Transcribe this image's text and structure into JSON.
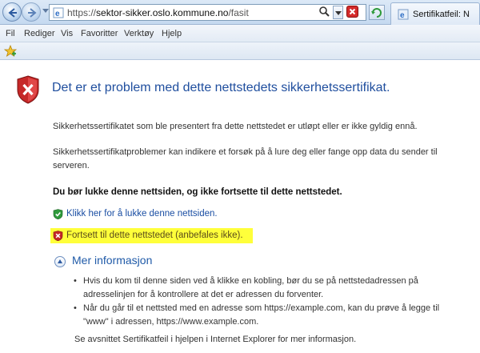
{
  "browser": {
    "url_scheme": "https://",
    "url_host": "sektor-sikker.oslo.kommune.no",
    "url_path": "/fasit",
    "tab_title": "Sertifikatfeil: N"
  },
  "menu": {
    "items": [
      "Fil",
      "Rediger",
      "Vis",
      "Favoritter",
      "Verktøy",
      "Hjelp"
    ]
  },
  "page": {
    "heading": "Det er et problem med dette nettstedets sikkerhetssertifikat.",
    "para1": "Sikkerhetssertifikatet som ble presentert fra dette nettstedet er utløpt eller er ikke gyldig ennå.",
    "para2": "Sikkerhetssertifikatproblemer kan indikere et forsøk på å lure deg eller fange opp data du sender til serveren.",
    "recommendation": "Du bør lukke denne nettsiden, og ikke fortsette til dette nettstedet.",
    "close_link": "Klikk her for å lukke denne nettsiden.",
    "continue_link": "Fortsett til dette nettstedet (anbefales ikke).",
    "more_info": "Mer informasjon",
    "bullets": [
      "Hvis du kom til denne siden ved å klikke en kobling, bør du se på nettstedadressen på adresselinjen for å kontrollere at det er adressen du forventer.",
      "Når du går til et nettsted med en adresse som https://example.com, kan du prøve å legge til \"www\" i adressen, https://www.example.com."
    ],
    "footer": "Se avsnittet Sertifikatfeil i hjelpen i Internet Explorer for mer informasjon."
  },
  "colors": {
    "heading": "#1f4e9e",
    "link": "#1a4ea3",
    "highlight": "#ffff3a",
    "error_red": "#d42a2a"
  },
  "icons": {
    "back": "back-arrow-icon",
    "forward": "forward-arrow-icon",
    "page": "ie-page-icon",
    "search": "search-icon",
    "certificate_error": "certificate-error-icon",
    "refresh": "refresh-icon",
    "favorites": "favorites-star-icon",
    "shield": "error-shield-icon",
    "close_link": "green-shield-check-icon",
    "continue_link": "red-shield-x-icon",
    "more_info": "chevron-up-circle-icon"
  }
}
